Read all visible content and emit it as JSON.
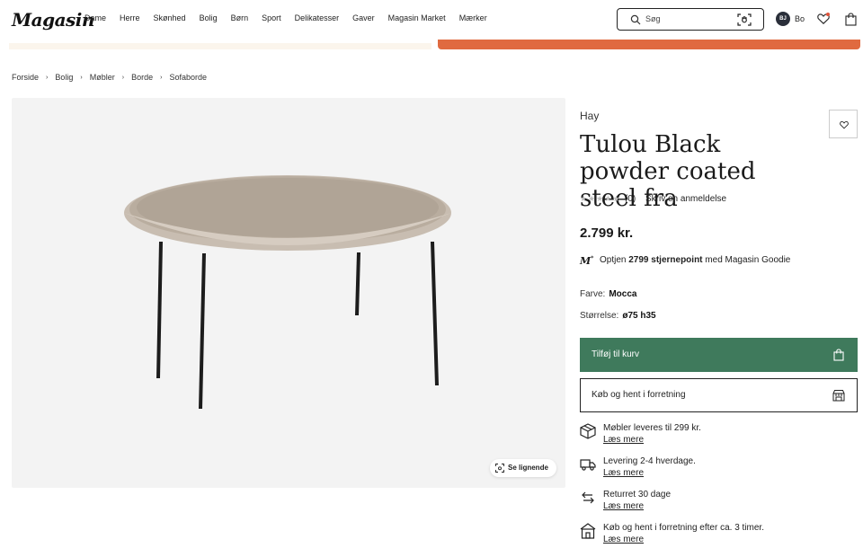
{
  "header": {
    "logo": "Magasin",
    "nav": [
      "Dame",
      "Herre",
      "Skønhed",
      "Bolig",
      "Børn",
      "Sport",
      "Delikatesser",
      "Gaver",
      "Magasin Market",
      "Mærker"
    ],
    "search_placeholder": "Søg",
    "user_initials": "BJ",
    "user_name": "Bo"
  },
  "breadcrumb": [
    "Forside",
    "Bolig",
    "Møbler",
    "Borde",
    "Sofaborde"
  ],
  "image_panel": {
    "similar_label": "Se lignende"
  },
  "product": {
    "brand": "Hay",
    "title": "Tulou Black powder coated steel fra",
    "rating_count": "(0)",
    "review_link": "Skriv en anmeldelse",
    "price": "2.799 kr.",
    "goodie_prefix": "Optjen",
    "goodie_points": "2799 stjernepoint",
    "goodie_suffix": "med Magasin Goodie",
    "color_label": "Farve:",
    "color_value": "Mocca",
    "size_label": "Størrelse:",
    "size_value": "ø75 h35",
    "add_to_cart": "Tilføj til kurv",
    "click_collect": "Køb og hent i forretning"
  },
  "info": [
    {
      "icon": "package-icon",
      "text": "Møbler leveres til 299 kr.",
      "link": "Læs mere"
    },
    {
      "icon": "truck-icon",
      "text": "Levering 2-4 hverdage.",
      "link": "Læs mere"
    },
    {
      "icon": "return-icon",
      "text": "Returret 30 dage",
      "link": "Læs mere"
    },
    {
      "icon": "store-icon",
      "text": "Køb og hent i forretning efter ca. 3 timer.",
      "link": "Læs mere"
    }
  ],
  "colors": {
    "primary_button": "#3f7a5c",
    "banner_accent": "#e06a40",
    "notification_dot": "#e0533a"
  }
}
